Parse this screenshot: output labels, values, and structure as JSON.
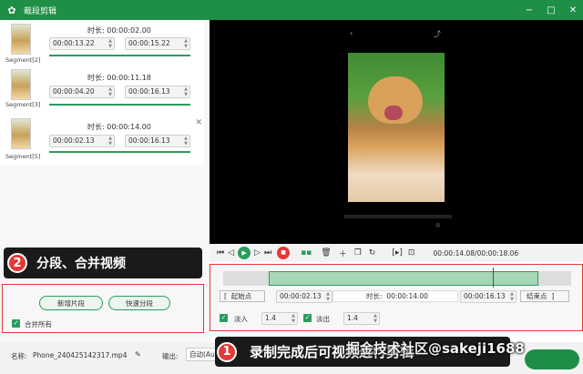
{
  "app": {
    "title": "裁段剪辑",
    "icon": "frog-icon"
  },
  "window_controls": [
    "−",
    "□",
    "✕"
  ],
  "segments": [
    {
      "label": "Segment[2]",
      "duration": "时长:  00:00:02.00",
      "start": "00:00:13.22",
      "end": "00:00:15.22"
    },
    {
      "label": "Segment[3]",
      "duration": "时长:  00:00:11.18",
      "start": "00:00:04.20",
      "end": "00:00:16.13"
    },
    {
      "label": "Segment[5]",
      "duration": "时长:  00:00:14.00",
      "start": "00:00:02.13",
      "end": "00:00:16.13"
    }
  ],
  "annotation_2": {
    "number": "2",
    "text": "分段、合并视频"
  },
  "annotation_1": {
    "number": "1",
    "text": "录制完成后可视频进行剪辑"
  },
  "actions": {
    "new_segment": "新增片段",
    "quick_split": "快速分段",
    "merge_all": "合并所有"
  },
  "filename": {
    "label": "名称:",
    "value": "Phone_240425142317.mp4",
    "output_label": "输出:",
    "output_value": "自动(Au"
  },
  "player": {
    "time": "00:00:14.08/00:00:18.06"
  },
  "timeline": {
    "start_btn": "起始点",
    "start_time": "00:00:02.13",
    "duration_label": "时长:",
    "duration": "00:00:14.00",
    "end_time": "00:00:16.13",
    "end_btn": "结束点",
    "fade_in_label": "淡入",
    "fade_in": "1.4",
    "fade_out_label": "淡出",
    "fade_out": "1.4"
  },
  "watermark": "掘金技术社区@sakeji1688"
}
